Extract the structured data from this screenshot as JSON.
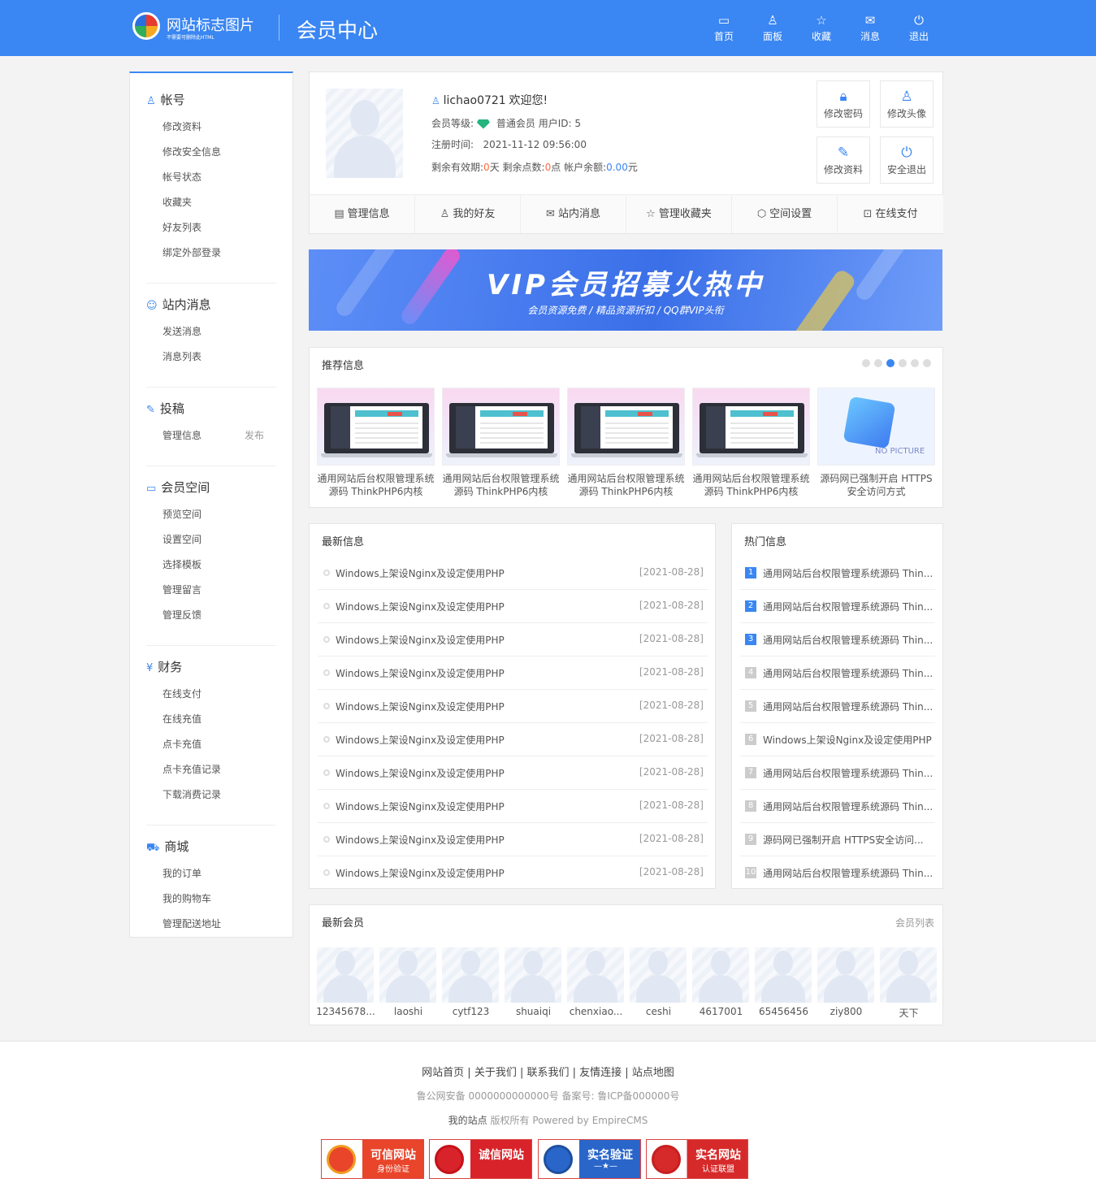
{
  "header": {
    "logo_title": "网站标志图片",
    "logo_sub": "不需要可删除此HTML",
    "title": "会员中心",
    "nav": [
      {
        "icon": "monitor-icon",
        "glyph": "▭",
        "label": "首页"
      },
      {
        "icon": "user-icon",
        "glyph": "♙",
        "label": "面板"
      },
      {
        "icon": "star-icon",
        "glyph": "☆",
        "label": "收藏"
      },
      {
        "icon": "mail-icon",
        "glyph": "✉",
        "label": "消息"
      },
      {
        "icon": "power-icon",
        "glyph": "⏻",
        "label": "退出"
      }
    ],
    "color": "#3a86f2"
  },
  "sidebar": {
    "sections": [
      {
        "title": "帐号",
        "glyph": "♙",
        "icon": "user-icon",
        "links": [
          "修改资料",
          "修改安全信息",
          "帐号状态",
          "收藏夹",
          "好友列表",
          "绑定外部登录"
        ]
      },
      {
        "title": "站内消息",
        "glyph": "☺",
        "icon": "message-icon",
        "links": [
          "发送消息",
          "消息列表"
        ]
      },
      {
        "title": "投稿",
        "glyph": "✎",
        "icon": "pen-icon",
        "links": [
          "管理信息"
        ],
        "extra": "发布"
      },
      {
        "title": "会员空间",
        "glyph": "▭",
        "icon": "monitor-icon",
        "links": [
          "预览空间",
          "设置空间",
          "选择模板",
          "管理留言",
          "管理反馈"
        ]
      },
      {
        "title": "财务",
        "glyph": "¥",
        "icon": "wallet-icon",
        "links": [
          "在线支付",
          "在线充值",
          "点卡充值",
          "点卡充值记录",
          "下载消费记录"
        ]
      },
      {
        "title": "商城",
        "glyph": "⛟",
        "icon": "cart-icon",
        "links": [
          "我的订单",
          "我的购物车",
          "管理配送地址"
        ]
      }
    ]
  },
  "user": {
    "name": "lichao0721",
    "welcome": "欢迎您!",
    "level_label": "会员等级:",
    "level": "普通会员",
    "uid_label": "用户ID:",
    "uid": "5",
    "reg_label": "注册时间:",
    "reg_time": "2021-11-12 09:56:00",
    "expire_label": "剩余有效期:",
    "expire_days": "0",
    "expire_unit": "天",
    "points_label": "剩余点数:",
    "points": "0",
    "points_unit": "点",
    "balance_label": "帐户余额:",
    "balance": "0.00",
    "balance_unit": "元"
  },
  "quick_buttons": [
    {
      "icon": "lock-icon",
      "glyph": "🔒︎",
      "label": "修改密码"
    },
    {
      "icon": "user-edit-icon",
      "glyph": "♙",
      "label": "修改头像"
    },
    {
      "icon": "edit-icon",
      "glyph": "✎",
      "label": "修改资料"
    },
    {
      "icon": "power-icon",
      "glyph": "⏻",
      "label": "安全退出"
    }
  ],
  "tabs": [
    {
      "icon": "doc-icon",
      "glyph": "▤",
      "label": "管理信息"
    },
    {
      "icon": "user-icon",
      "glyph": "♙",
      "label": "我的好友"
    },
    {
      "icon": "mail-icon",
      "glyph": "✉",
      "label": "站内消息"
    },
    {
      "icon": "star-icon",
      "glyph": "☆",
      "label": "管理收藏夹"
    },
    {
      "icon": "cube-icon",
      "glyph": "⬡",
      "label": "空间设置"
    },
    {
      "icon": "bag-icon",
      "glyph": "⊡",
      "label": "在线支付"
    }
  ],
  "banner": {
    "title": "VIP会员招募火热中",
    "subtitle": "会员资源免费 / 精品资源折扣 / QQ群VIP头衔"
  },
  "recommend": {
    "title": "推荐信息",
    "slide_count": 6,
    "active_slide": 3,
    "items": [
      {
        "line1": "通用网站后台权限管理系统",
        "line2": "源码 ThinkPHP6内核",
        "image": "laptop"
      },
      {
        "line1": "通用网站后台权限管理系统",
        "line2": "源码 ThinkPHP6内核",
        "image": "laptop"
      },
      {
        "line1": "通用网站后台权限管理系统",
        "line2": "源码 ThinkPHP6内核",
        "image": "laptop"
      },
      {
        "line1": "通用网站后台权限管理系统",
        "line2": "源码 ThinkPHP6内核",
        "image": "laptop"
      },
      {
        "line1": "源码网已强制开启 HTTPS",
        "line2": "安全访问方式",
        "image": "nopic"
      }
    ],
    "nopic_text": "NO PICTURE"
  },
  "latest": {
    "title": "最新信息",
    "items": [
      {
        "text": "Windows上架设Nginx及设定使用PHP",
        "date": "[2021-08-28]"
      },
      {
        "text": "Windows上架设Nginx及设定使用PHP",
        "date": "[2021-08-28]"
      },
      {
        "text": "Windows上架设Nginx及设定使用PHP",
        "date": "[2021-08-28]"
      },
      {
        "text": "Windows上架设Nginx及设定使用PHP",
        "date": "[2021-08-28]"
      },
      {
        "text": "Windows上架设Nginx及设定使用PHP",
        "date": "[2021-08-28]"
      },
      {
        "text": "Windows上架设Nginx及设定使用PHP",
        "date": "[2021-08-28]"
      },
      {
        "text": "Windows上架设Nginx及设定使用PHP",
        "date": "[2021-08-28]"
      },
      {
        "text": "Windows上架设Nginx及设定使用PHP",
        "date": "[2021-08-28]"
      },
      {
        "text": "Windows上架设Nginx及设定使用PHP",
        "date": "[2021-08-28]"
      },
      {
        "text": "Windows上架设Nginx及设定使用PHP",
        "date": "[2021-08-28]"
      }
    ]
  },
  "hot": {
    "title": "热门信息",
    "items": [
      {
        "num": "1",
        "text": "通用网站后台权限管理系统源码 Thin..."
      },
      {
        "num": "2",
        "text": "通用网站后台权限管理系统源码 Thin..."
      },
      {
        "num": "3",
        "text": "通用网站后台权限管理系统源码 Thin..."
      },
      {
        "num": "4",
        "text": "通用网站后台权限管理系统源码 Thin..."
      },
      {
        "num": "5",
        "text": "通用网站后台权限管理系统源码 Thin..."
      },
      {
        "num": "6",
        "text": "Windows上架设Nginx及设定使用PHP"
      },
      {
        "num": "7",
        "text": "通用网站后台权限管理系统源码 Thin..."
      },
      {
        "num": "8",
        "text": "通用网站后台权限管理系统源码 Thin..."
      },
      {
        "num": "9",
        "text": "源码网已强制开启 HTTPS安全访问..."
      },
      {
        "num": "10",
        "text": "通用网站后台权限管理系统源码 Thin..."
      }
    ]
  },
  "members": {
    "title": "最新会员",
    "more": "会员列表",
    "items": [
      "12345678...",
      "laoshi",
      "cytf123",
      "shuaiqi",
      "chenxiao...",
      "ceshi",
      "4617001",
      "65456456",
      "ziy800",
      "天下"
    ]
  },
  "footer": {
    "links": [
      "网站首页",
      "关于我们",
      "联系我们",
      "友情连接",
      "站点地图"
    ],
    "separator": " | ",
    "icp": "鲁公网安备 0000000000000号 备案号: 鲁ICP备000000号",
    "site_name": "我的站点",
    "copyright": "版权所有 Powered by EmpireCMS",
    "badges": [
      {
        "title": "可信网站",
        "sub": "身份验证"
      },
      {
        "title": "诚信网站",
        "sub": ""
      },
      {
        "title": "实名验证",
        "sub": "—★—"
      },
      {
        "title": "实名网站",
        "sub": "认证联盟"
      }
    ]
  }
}
